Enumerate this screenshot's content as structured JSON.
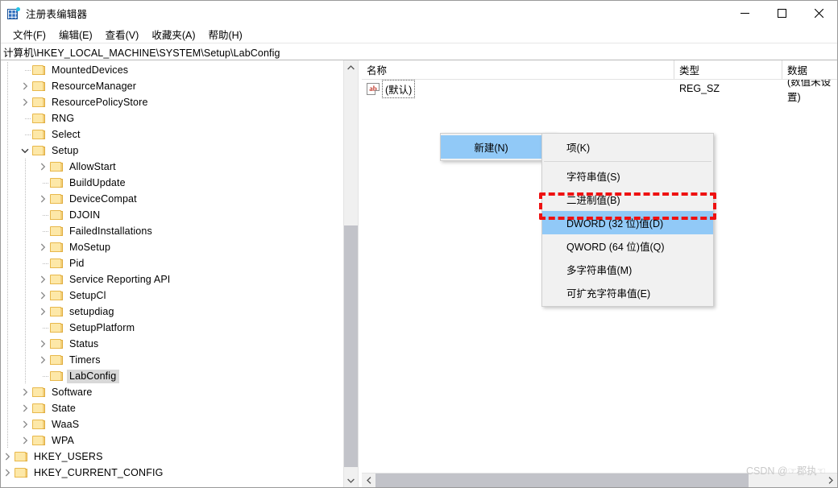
{
  "window": {
    "title": "注册表编辑器",
    "app_icon": "registry-editor-icon",
    "controls": {
      "minimize": "最小化",
      "maximize": "最大化",
      "close": "关闭"
    }
  },
  "menubar": {
    "items": [
      {
        "label": "文件(F)",
        "name": "menu-file"
      },
      {
        "label": "编辑(E)",
        "name": "menu-edit"
      },
      {
        "label": "查看(V)",
        "name": "menu-view"
      },
      {
        "label": "收藏夹(A)",
        "name": "menu-favorites"
      },
      {
        "label": "帮助(H)",
        "name": "menu-help"
      }
    ]
  },
  "address": {
    "path": "计算机\\HKEY_LOCAL_MACHINE\\SYSTEM\\Setup\\LabConfig"
  },
  "tree": {
    "items": [
      {
        "label": "MountedDevices",
        "depth": 2,
        "twist": "none",
        "selected": false
      },
      {
        "label": "ResourceManager",
        "depth": 2,
        "twist": "collapsed",
        "selected": false
      },
      {
        "label": "ResourcePolicyStore",
        "depth": 2,
        "twist": "collapsed",
        "selected": false
      },
      {
        "label": "RNG",
        "depth": 2,
        "twist": "none",
        "selected": false
      },
      {
        "label": "Select",
        "depth": 2,
        "twist": "none",
        "selected": false
      },
      {
        "label": "Setup",
        "depth": 2,
        "twist": "expanded",
        "selected": false
      },
      {
        "label": "AllowStart",
        "depth": 3,
        "twist": "collapsed",
        "selected": false
      },
      {
        "label": "BuildUpdate",
        "depth": 3,
        "twist": "none",
        "selected": false
      },
      {
        "label": "DeviceCompat",
        "depth": 3,
        "twist": "collapsed",
        "selected": false
      },
      {
        "label": "DJOIN",
        "depth": 3,
        "twist": "none",
        "selected": false
      },
      {
        "label": "FailedInstallations",
        "depth": 3,
        "twist": "none",
        "selected": false
      },
      {
        "label": "MoSetup",
        "depth": 3,
        "twist": "collapsed",
        "selected": false
      },
      {
        "label": "Pid",
        "depth": 3,
        "twist": "none",
        "selected": false
      },
      {
        "label": "Service Reporting API",
        "depth": 3,
        "twist": "collapsed",
        "selected": false
      },
      {
        "label": "SetupCl",
        "depth": 3,
        "twist": "collapsed",
        "selected": false
      },
      {
        "label": "setupdiag",
        "depth": 3,
        "twist": "collapsed",
        "selected": false
      },
      {
        "label": "SetupPlatform",
        "depth": 3,
        "twist": "none",
        "selected": false
      },
      {
        "label": "Status",
        "depth": 3,
        "twist": "collapsed",
        "selected": false
      },
      {
        "label": "Timers",
        "depth": 3,
        "twist": "collapsed",
        "selected": false
      },
      {
        "label": "LabConfig",
        "depth": 3,
        "twist": "none",
        "selected": true
      },
      {
        "label": "Software",
        "depth": 2,
        "twist": "collapsed",
        "selected": false
      },
      {
        "label": "State",
        "depth": 2,
        "twist": "collapsed",
        "selected": false
      },
      {
        "label": "WaaS",
        "depth": 2,
        "twist": "collapsed",
        "selected": false
      },
      {
        "label": "WPA",
        "depth": 2,
        "twist": "collapsed",
        "selected": false
      },
      {
        "label": "HKEY_USERS",
        "depth": 1,
        "twist": "collapsed",
        "selected": false
      },
      {
        "label": "HKEY_CURRENT_CONFIG",
        "depth": 1,
        "twist": "collapsed",
        "selected": false
      }
    ]
  },
  "listview": {
    "columns": [
      {
        "label": "名称",
        "name": "column-name"
      },
      {
        "label": "类型",
        "name": "column-type"
      },
      {
        "label": "数据",
        "name": "column-data"
      }
    ],
    "rows": [
      {
        "name": "(默认)",
        "type": "REG_SZ",
        "data": "(数值未设置)",
        "icon": "string-value-icon",
        "focused": true
      }
    ]
  },
  "context_menu": {
    "parent": {
      "label": "新建(N)",
      "highlighted": true,
      "has_submenu": true
    },
    "submenu_items": [
      {
        "label": "项(K)",
        "highlighted": false,
        "separator_after": true
      },
      {
        "label": "字符串值(S)",
        "highlighted": false,
        "separator_after": false
      },
      {
        "label": "二进制值(B)",
        "highlighted": false,
        "separator_after": false
      },
      {
        "label": "DWORD (32 位)值(D)",
        "highlighted": true,
        "separator_after": false
      },
      {
        "label": "QWORD (64 位)值(Q)",
        "highlighted": false,
        "separator_after": false
      },
      {
        "label": "多字符串值(M)",
        "highlighted": false,
        "separator_after": false
      },
      {
        "label": "可扩充字符串值(E)",
        "highlighted": false,
        "separator_after": false
      }
    ]
  },
  "annotation": {
    "target_label": "DWORD (32 位)值(D)",
    "color": "#ee1111",
    "style": "dashed-rectangle"
  },
  "watermark": {
    "text": "CSDN @☞郡执☜"
  },
  "colors": {
    "highlight_blue": "#91c9f7",
    "selection_grey": "#d8d8d8",
    "folder_yellow": "#fde8a8",
    "annotation_red": "#ee1111",
    "scrollbar_thumb": "#c2c3c9"
  }
}
